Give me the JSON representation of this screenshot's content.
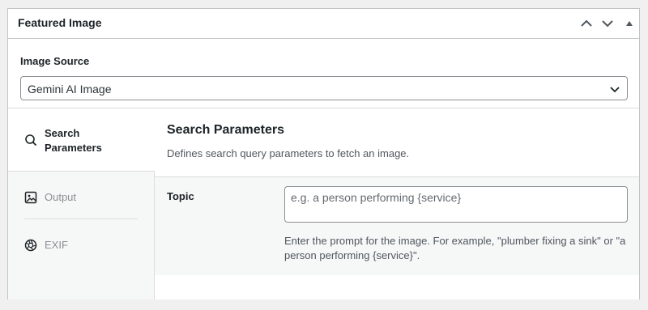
{
  "panel": {
    "title": "Featured Image",
    "controls": [
      "chevron-up-icon",
      "chevron-down-icon",
      "triangle-up-icon"
    ]
  },
  "image_source": {
    "label": "Image Source",
    "selected": "Gemini AI Image"
  },
  "tabs": [
    {
      "label": "Search Parameters",
      "icon": "search-icon",
      "active": true
    },
    {
      "label": "Output",
      "icon": "image-icon",
      "active": false
    },
    {
      "label": "EXIF",
      "icon": "aperture-icon",
      "active": false
    }
  ],
  "section": {
    "title": "Search Parameters",
    "description": "Defines search query parameters to fetch an image."
  },
  "topic": {
    "label": "Topic",
    "placeholder": "e.g. a person performing {service}",
    "value": "",
    "help": "Enter the prompt for the image. For example, \"plumber fixing a sink\" or \"a person performing {service}\"."
  },
  "colors": {
    "border": "#c3c4c7",
    "text": "#1d2327",
    "muted": "#8c8f94",
    "panel_bg": "#f6f7f7"
  }
}
